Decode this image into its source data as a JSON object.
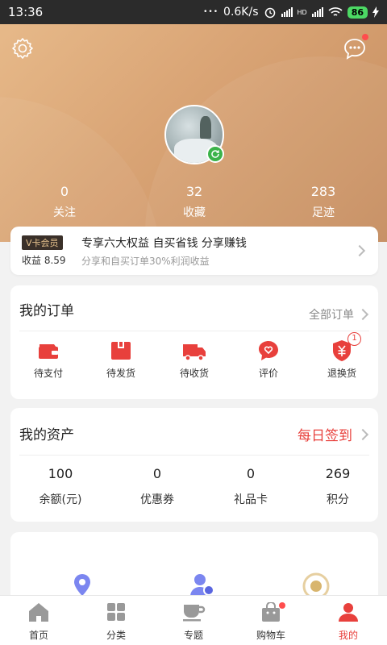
{
  "status_bar": {
    "time": "13:36",
    "net_speed": "0.6K/s",
    "network_type": "HD",
    "battery": "86"
  },
  "header": {
    "settings_icon": "gear-icon",
    "messages_icon": "chat-bubble-icon",
    "stats": [
      {
        "value": "0",
        "label": "关注"
      },
      {
        "value": "32",
        "label": "收藏"
      },
      {
        "value": "283",
        "label": "足迹"
      }
    ]
  },
  "vcard": {
    "tag": "V卡会员",
    "earnings": "收益 8.59",
    "title": "专享六大权益 自买省钱 分享赚钱",
    "subtitle": "分享和自买订单30%利润收益"
  },
  "orders": {
    "title": "我的订单",
    "all_link": "全部订单",
    "items": [
      {
        "label": "待支付",
        "icon": "wallet-icon"
      },
      {
        "label": "待发货",
        "icon": "box-icon"
      },
      {
        "label": "待收货",
        "icon": "truck-icon"
      },
      {
        "label": "评价",
        "icon": "heart-chat-icon"
      },
      {
        "label": "退换货",
        "icon": "yen-shield-icon",
        "badge": "1"
      }
    ]
  },
  "assets": {
    "title": "我的资产",
    "checkin": "每日签到",
    "items": [
      {
        "value": "100",
        "label": "余额(元)"
      },
      {
        "value": "0",
        "label": "优惠券"
      },
      {
        "value": "0",
        "label": "礼品卡"
      },
      {
        "value": "269",
        "label": "积分"
      }
    ]
  },
  "tabbar": {
    "items": [
      {
        "label": "首页",
        "icon": "home-icon"
      },
      {
        "label": "分类",
        "icon": "grid-icon"
      },
      {
        "label": "专题",
        "icon": "cup-icon"
      },
      {
        "label": "购物车",
        "icon": "shopping-bag-icon"
      },
      {
        "label": "我的",
        "icon": "user-icon"
      }
    ],
    "active": "我的"
  },
  "colors": {
    "accent_red": "#e8403c",
    "header_gold": "#d9a475"
  }
}
